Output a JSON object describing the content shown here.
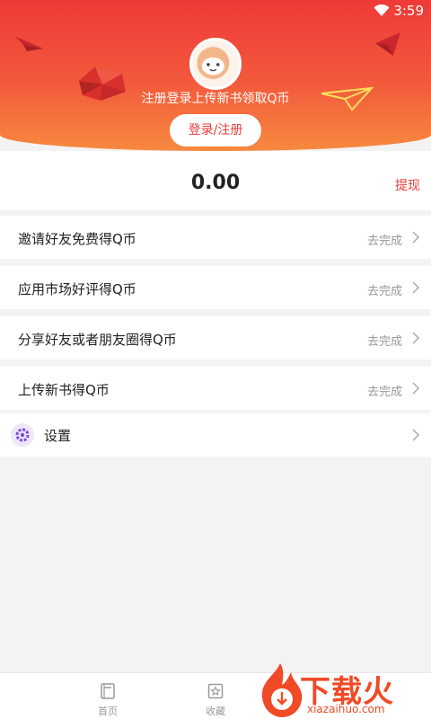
{
  "status_bar": {
    "time": "3:59"
  },
  "header": {
    "promo_text": "注册登录上传新书领取Q币",
    "login_label": "登录/注册"
  },
  "balance": {
    "value": "0.00",
    "withdraw_label": "提现"
  },
  "tasks": [
    {
      "title": "邀请好友免费得Q币",
      "action": "去完成"
    },
    {
      "title": "应用市场好评得Q币",
      "action": "去完成"
    },
    {
      "title": "分享好友或者朋友圈得Q币",
      "action": "去完成"
    },
    {
      "title": "上传新书得Q币",
      "action": "去完成"
    }
  ],
  "settings": {
    "label": "设置"
  },
  "tabs": [
    {
      "label": "首页",
      "icon": "book-icon"
    },
    {
      "label": "收藏",
      "icon": "star-box-icon"
    }
  ],
  "watermark": {
    "title": "下载火",
    "subtitle": "xiazaihuo.com"
  },
  "colors": {
    "accent": "#ea3b3b",
    "header_top": "#ef3a38",
    "header_bottom": "#f7893f"
  }
}
